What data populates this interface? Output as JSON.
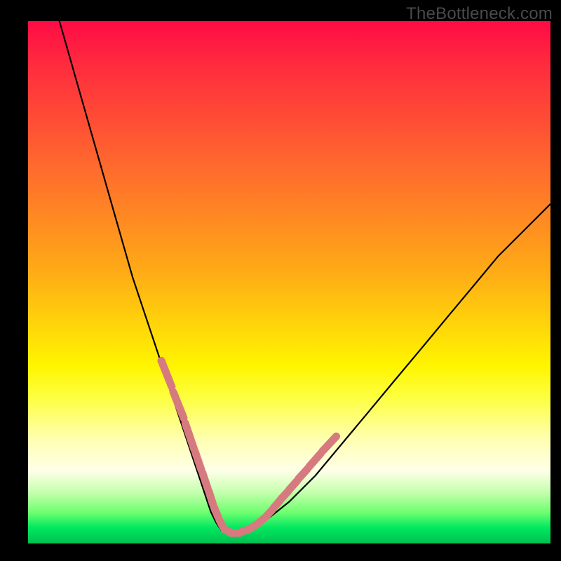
{
  "watermark": "TheBottleneck.com",
  "chart_data": {
    "type": "line",
    "title": "",
    "xlabel": "",
    "ylabel": "",
    "xlim": [
      0,
      100
    ],
    "ylim": [
      0,
      100
    ],
    "series": [
      {
        "name": "bottleneck-curve",
        "x": [
          6,
          8,
          10,
          12,
          14,
          16,
          18,
          20,
          22,
          24,
          26,
          28,
          30,
          32,
          33,
          34,
          35,
          36,
          37,
          38,
          40,
          42,
          45,
          50,
          55,
          60,
          65,
          70,
          75,
          80,
          85,
          90,
          95,
          100
        ],
        "y": [
          100,
          93,
          86,
          79,
          72,
          65,
          58,
          51,
          45,
          39,
          33,
          27,
          21,
          15,
          12,
          9,
          6,
          4,
          2.5,
          2,
          2,
          2.5,
          4,
          8,
          13,
          19,
          25,
          31,
          37,
          43,
          49,
          55,
          60,
          65
        ]
      }
    ],
    "markers": {
      "name": "highlight-dashes",
      "color": "#d77a7f",
      "segments": [
        {
          "x": [
            25.5,
            27.5
          ],
          "y": [
            35,
            30
          ]
        },
        {
          "x": [
            27.8,
            29.8
          ],
          "y": [
            29,
            24
          ]
        },
        {
          "x": [
            30.1,
            31.8
          ],
          "y": [
            23,
            18
          ]
        },
        {
          "x": [
            32.0,
            33.2
          ],
          "y": [
            17.5,
            14
          ]
        },
        {
          "x": [
            33.4,
            34.4
          ],
          "y": [
            13.5,
            10.5
          ]
        },
        {
          "x": [
            34.6,
            35.4
          ],
          "y": [
            10,
            7.5
          ]
        },
        {
          "x": [
            35.6,
            36.4
          ],
          "y": [
            7,
            5
          ]
        },
        {
          "x": [
            36.6,
            37.4
          ],
          "y": [
            4.5,
            3
          ]
        },
        {
          "x": [
            37.6,
            38.6
          ],
          "y": [
            2.7,
            2.2
          ]
        },
        {
          "x": [
            38.8,
            40.5
          ],
          "y": [
            2,
            2
          ]
        },
        {
          "x": [
            40.8,
            42.5
          ],
          "y": [
            2.2,
            2.8
          ]
        },
        {
          "x": [
            42.8,
            44.0
          ],
          "y": [
            3.0,
            3.8
          ]
        },
        {
          "x": [
            44.2,
            45.4
          ],
          "y": [
            4.0,
            5.0
          ]
        },
        {
          "x": [
            45.6,
            46.8
          ],
          "y": [
            5.2,
            6.5
          ]
        },
        {
          "x": [
            47.0,
            48.2
          ],
          "y": [
            6.8,
            8.2
          ]
        },
        {
          "x": [
            48.4,
            49.8
          ],
          "y": [
            8.5,
            10.0
          ]
        },
        {
          "x": [
            50.0,
            51.5
          ],
          "y": [
            10.3,
            12.0
          ]
        },
        {
          "x": [
            51.8,
            53.5
          ],
          "y": [
            12.4,
            14.3
          ]
        },
        {
          "x": [
            53.8,
            56.0
          ],
          "y": [
            14.7,
            17.2
          ]
        },
        {
          "x": [
            56.3,
            59.0
          ],
          "y": [
            17.6,
            20.5
          ]
        }
      ]
    }
  }
}
